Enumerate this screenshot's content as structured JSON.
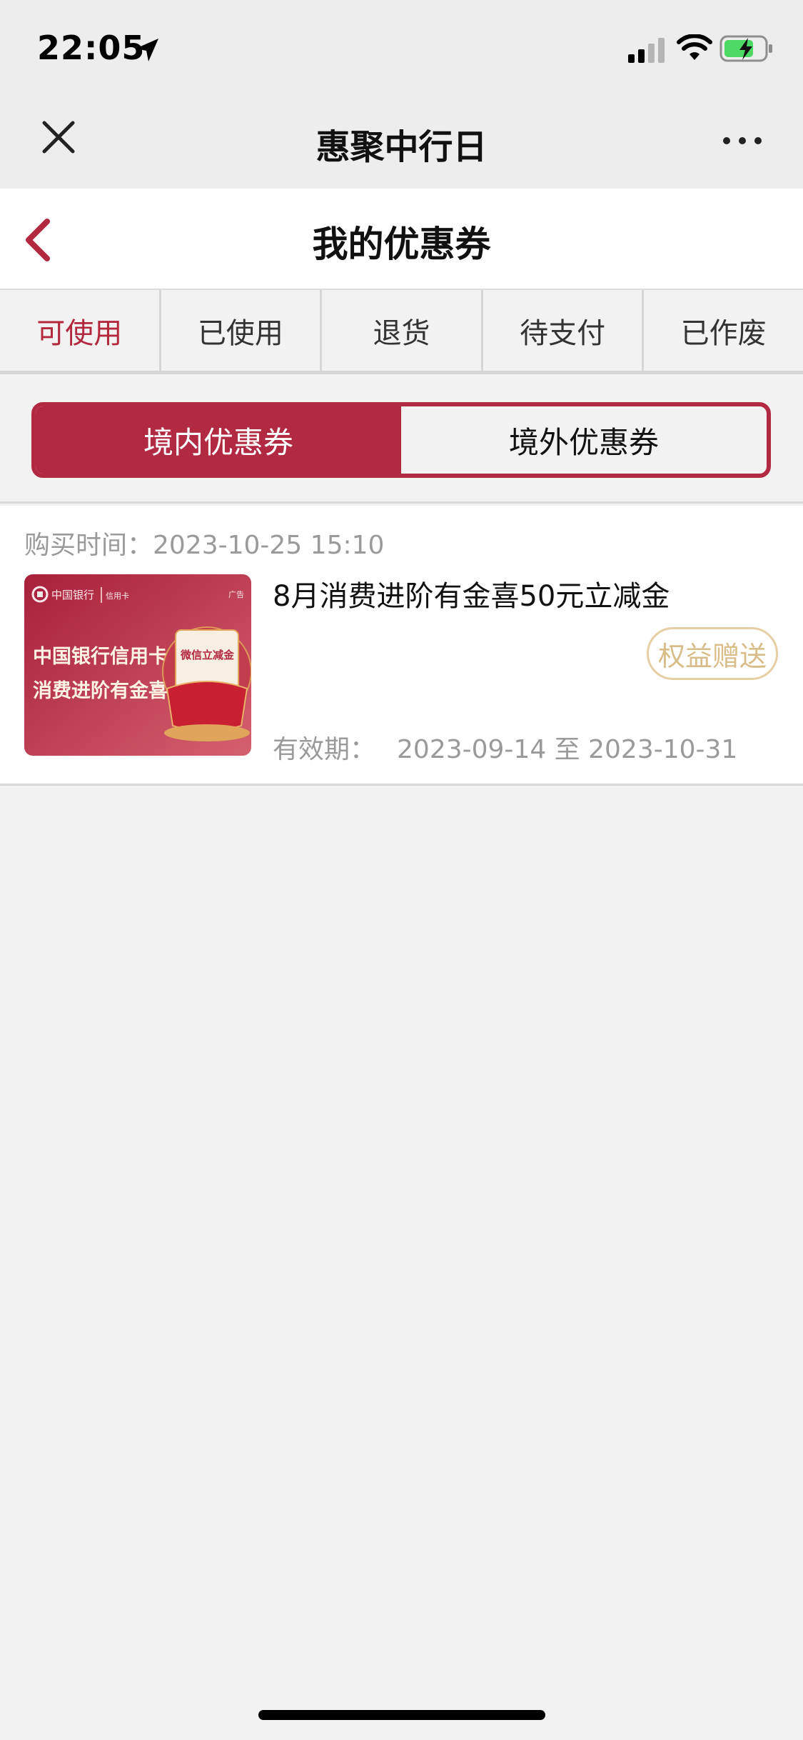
{
  "status_bar": {
    "time": "22:05",
    "icons": [
      "location-arrow-icon",
      "signal-icon",
      "wifi-icon",
      "battery-charging-icon"
    ]
  },
  "nav": {
    "title": "惠聚中行日",
    "close_icon": "close-icon",
    "more_icon": "more-icon"
  },
  "header": {
    "title": "我的优惠券",
    "back_icon": "chevron-left-icon"
  },
  "tabs": [
    {
      "label": "可使用",
      "active": true
    },
    {
      "label": "已使用",
      "active": false
    },
    {
      "label": "退货",
      "active": false
    },
    {
      "label": "待支付",
      "active": false
    },
    {
      "label": "已作废",
      "active": false
    }
  ],
  "segment": [
    {
      "label": "境内优惠券",
      "active": true
    },
    {
      "label": "境外优惠券",
      "active": false
    }
  ],
  "coupon": {
    "purchase_time": "购买时间：2023-10-25 15:10",
    "title": "8月消费进阶有金喜50元立减金",
    "badge": "权益赠送",
    "validity_label": "有效期：",
    "validity_range": "2023-09-14 至 2023-10-31",
    "thumbnail": {
      "brand": "中国银行",
      "brand_sub": "信用卡",
      "ad_tag": "广告",
      "line1": "中国银行信用卡",
      "line2": "消费进阶有金喜",
      "sticker": "微信立减金"
    }
  },
  "colors": {
    "accent": "#b22a41",
    "badge_border": "#e6cfa4",
    "badge_text": "#d9bd88",
    "muted_text": "#9a9a9a"
  }
}
